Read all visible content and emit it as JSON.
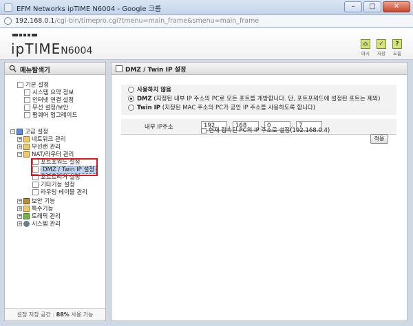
{
  "window": {
    "title": "EFM Networks ipTIME N6004 - Google 크롬",
    "min": "–",
    "max": "□",
    "close": "✕"
  },
  "address": {
    "host": "192.168.0.1",
    "path": "/cgi-bin/timepro.cgi?tmenu=main_frame&smenu=main_frame"
  },
  "header": {
    "logo": "ipTIME",
    "model": "N6004",
    "buttons": [
      {
        "icon": "home-icon",
        "glyph": "⌂",
        "label": "마시"
      },
      {
        "icon": "save-icon",
        "glyph": "✓",
        "label": "저장"
      },
      {
        "icon": "help-icon",
        "glyph": "?",
        "label": "도움"
      }
    ]
  },
  "sidebar": {
    "title": "메뉴탐색기",
    "basic": {
      "label": "기본 설정",
      "items": [
        "시스템 요약 정보",
        "인터넷 연결 설정",
        "무선 설정/보안",
        "펌웨어 업그레이드"
      ]
    },
    "advanced": {
      "label": "고급 설정",
      "items": [
        "네트워크 관리",
        "무선랜 관리"
      ],
      "nat": {
        "label": "NAT/라우터 관리",
        "items": [
          "포트포워드 설정",
          "DMZ / Twin IP 설정",
          "포트트리거 설정",
          "기타기능 설정",
          "라우팅 테이블 관리"
        ]
      },
      "more": [
        "보안 기능",
        "특수기능",
        "트래픽 관리",
        "시스템 관리"
      ]
    },
    "footer": {
      "prefix": "설정 저장 공간 : ",
      "value": "88%",
      "suffix": " 사용 가능"
    }
  },
  "main": {
    "title": "DMZ / Twin IP 설정",
    "options": [
      {
        "label": "사용하지 않음",
        "desc": "",
        "checked": false
      },
      {
        "label": "DMZ",
        "desc": " (지정된 내부 IP 주소의 PC로 모든 포트를 개방합니다. 단, 포트포워드에 설정된 포트는 제외)",
        "checked": true
      },
      {
        "label": "Twin IP",
        "desc": " (지정된 MAC 주소의 PC가 공인 IP 주소를 사용하도록 합니다)",
        "checked": false
      }
    ],
    "ip_label": "내부 IP주소",
    "ip": [
      "192",
      "168",
      "0",
      "7"
    ],
    "current_pc_label": "현재 접속된 PC의 IP 주소로 설정(192.168.0.4)",
    "apply": "적용"
  }
}
